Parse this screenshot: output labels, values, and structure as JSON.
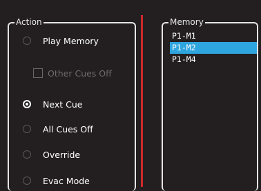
{
  "action": {
    "title": "Action",
    "play_memory": {
      "label": "Play Memory",
      "checked": false
    },
    "other_cues_off": {
      "label": "Other Cues Off",
      "checked": false,
      "enabled": false
    },
    "next_cue": {
      "label": "Next Cue",
      "checked": true
    },
    "all_cues_off": {
      "label": "All Cues Off",
      "checked": false
    },
    "override": {
      "label": "Override",
      "checked": false
    },
    "evac_mode": {
      "label": "Evac Mode",
      "checked": false
    }
  },
  "memory": {
    "title": "Memory",
    "items": [
      "P1-M1",
      "P1-M2",
      "P1-M4"
    ],
    "selected": "P1-M2"
  },
  "colors": {
    "background": "#231f20",
    "divider": "#d0282d",
    "selection": "#2fa5df"
  }
}
